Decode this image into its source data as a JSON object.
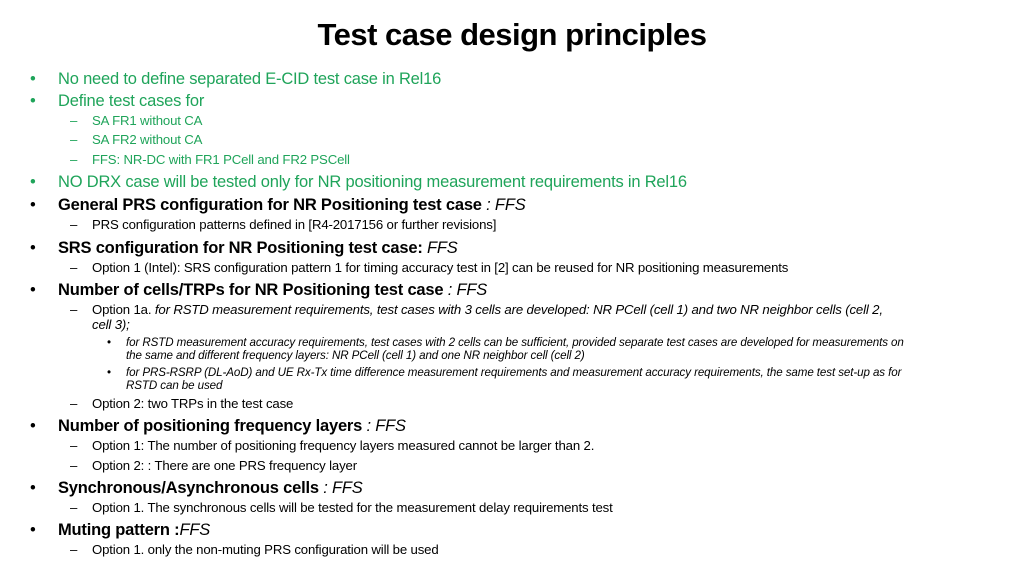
{
  "title": "Test case design principles",
  "lines": [
    {
      "marker": "•",
      "level": 1,
      "green": true,
      "parts": [
        {
          "t": "No need to define separated E-CID test case in Rel16"
        }
      ]
    },
    {
      "marker": "•",
      "level": 1,
      "green": true,
      "parts": [
        {
          "t": "Define test cases for"
        }
      ]
    },
    {
      "marker": "–",
      "level": 2,
      "green": true,
      "parts": [
        {
          "t": "SA FR1 without CA"
        }
      ]
    },
    {
      "marker": "–",
      "level": 2,
      "green": true,
      "parts": [
        {
          "t": "SA FR2 without CA"
        }
      ]
    },
    {
      "marker": "–",
      "level": 2,
      "green": true,
      "parts": [
        {
          "t": "FFS: NR-DC with FR1 PCell and FR2 PSCell"
        }
      ]
    },
    {
      "marker": "•",
      "level": 1,
      "green": true,
      "parts": [
        {
          "t": "NO DRX case will be tested only for NR positioning measurement requirements in Rel16"
        }
      ]
    },
    {
      "marker": "•",
      "level": 1,
      "parts": [
        {
          "t": "General PRS configuration for NR Positioning test case",
          "b": true
        },
        {
          "t": " : FFS",
          "i": true
        }
      ]
    },
    {
      "marker": "–",
      "level": 2,
      "parts": [
        {
          "t": "PRS configuration patterns defined in [R4-2017156 or further revisions]"
        }
      ]
    },
    {
      "marker": "•",
      "level": 1,
      "parts": [
        {
          "t": "SRS configuration for NR Positioning test case:",
          "b": true
        },
        {
          "t": " FFS",
          "i": true
        }
      ]
    },
    {
      "marker": "–",
      "level": 2,
      "parts": [
        {
          "t": "Option 1 (Intel):  SRS configuration pattern 1 for timing accuracy test in [2] can be reused for NR positioning measurements"
        }
      ]
    },
    {
      "marker": "•",
      "level": 1,
      "parts": [
        {
          "t": "Number of cells/TRPs for NR Positioning test case",
          "b": true
        },
        {
          "t": " : FFS",
          "i": true
        }
      ]
    },
    {
      "marker": "–",
      "level": 2,
      "parts": [
        {
          "t": "Option 1a. "
        },
        {
          "t": "for RSTD measurement requirements, test cases with 3 cells are developed: NR PCell (cell 1) and two NR neighbor cells (cell 2,",
          "i": true
        }
      ]
    },
    {
      "marker": "",
      "level": 2,
      "parts": [
        {
          "t": "cell 3);",
          "i": true
        }
      ]
    },
    {
      "marker": "•",
      "level": 3,
      "parts": [
        {
          "t": "for RSTD measurement accuracy requirements, test cases with 2 cells can be sufficient, provided separate test cases are developed for measurements on"
        }
      ]
    },
    {
      "marker": "",
      "level": 3,
      "parts": [
        {
          "t": "the same and different frequency layers: NR PCell (cell 1) and one NR neighbor cell (cell 2)"
        }
      ]
    },
    {
      "marker": "•",
      "level": 3,
      "parts": [
        {
          "t": "for PRS-RSRP (DL-AoD) and UE Rx-Tx time difference measurement requirements and measurement accuracy requirements, the same test set-up as for"
        }
      ]
    },
    {
      "marker": "",
      "level": 3,
      "parts": [
        {
          "t": "RSTD can be used"
        }
      ]
    },
    {
      "marker": "–",
      "level": 2,
      "parts": [
        {
          "t": "Option 2: two TRPs in the test case"
        }
      ]
    },
    {
      "marker": "•",
      "level": 1,
      "parts": [
        {
          "t": "Number of positioning frequency layers",
          "b": true
        },
        {
          "t": " : FFS",
          "i": true
        }
      ]
    },
    {
      "marker": "–",
      "level": 2,
      "parts": [
        {
          "t": "Option 1: The number of positioning frequency layers measured cannot be larger than 2."
        }
      ]
    },
    {
      "marker": "–",
      "level": 2,
      "parts": [
        {
          "t": "Option 2: : There are one PRS frequency layer"
        }
      ]
    },
    {
      "marker": "•",
      "level": 1,
      "parts": [
        {
          "t": "Synchronous/Asynchronous cells",
          "b": true
        },
        {
          "t": " : FFS",
          "i": true
        }
      ]
    },
    {
      "marker": "–",
      "level": 2,
      "parts": [
        {
          "t": "Option 1. The synchronous cells will be tested for the measurement delay requirements test"
        }
      ]
    },
    {
      "marker": "•",
      "level": 1,
      "parts": [
        {
          "t": "Muting pattern :",
          "b": true
        },
        {
          "t": "FFS",
          "i": true
        }
      ]
    },
    {
      "marker": "–",
      "level": 2,
      "parts": [
        {
          "t": "Option 1.  only the non-muting PRS configuration will be used"
        }
      ]
    }
  ]
}
